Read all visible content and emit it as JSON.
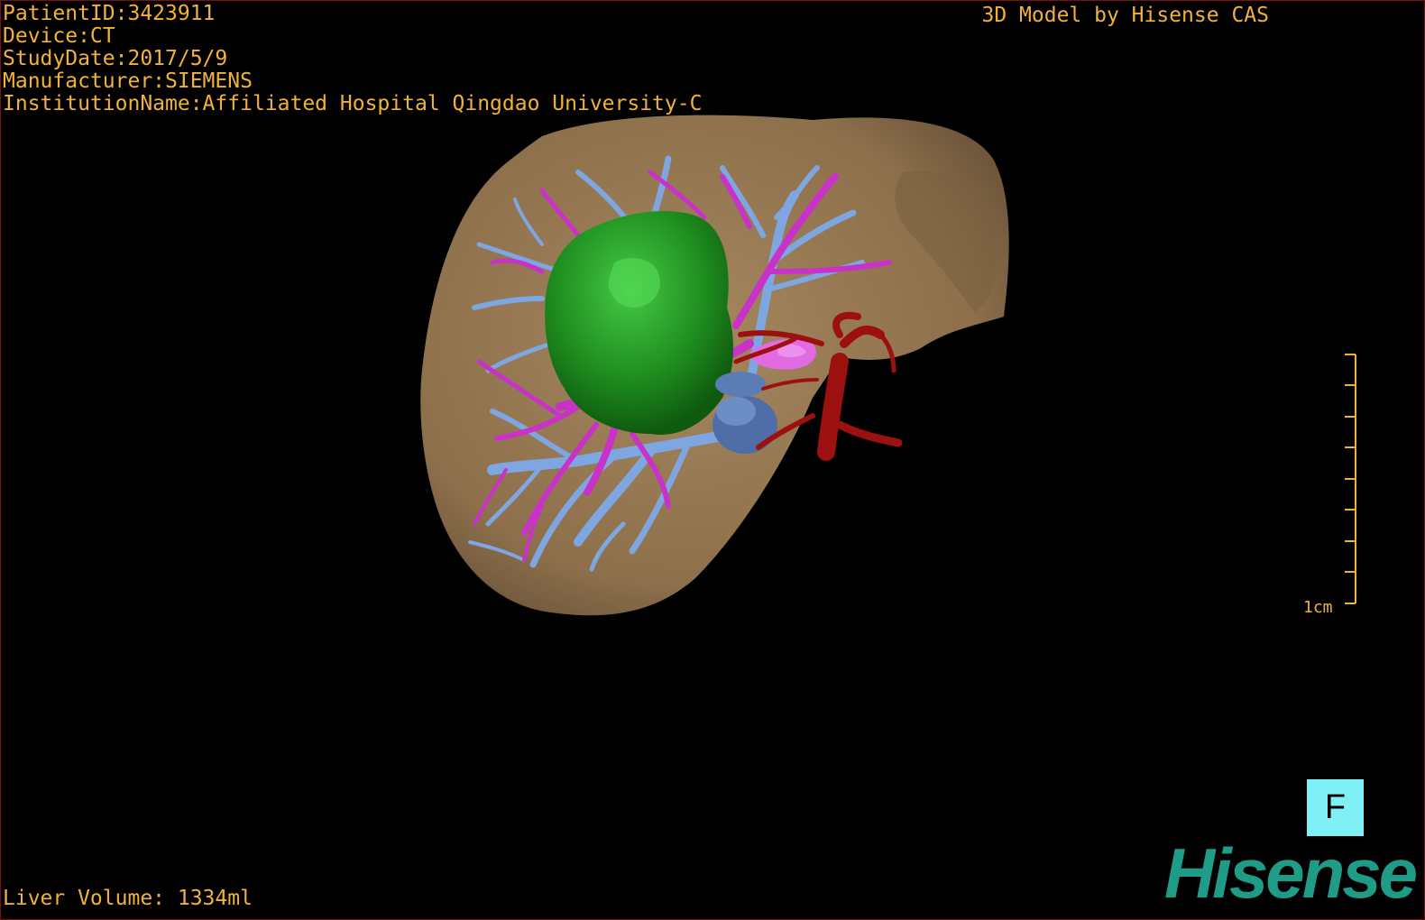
{
  "overlay": {
    "patient_id": "PatientID:3423911",
    "device": "Device:CT",
    "study_date": "StudyDate:2017/5/9",
    "manufacturer": "Manufacturer:SIEMENS",
    "institution": "InstitutionName:Affiliated Hospital Qingdao University-C",
    "brand_text": "3D Model by Hisense CAS",
    "liver_volume": "Liver Volume: 1334ml"
  },
  "scale_bar": {
    "label": "1cm"
  },
  "orientation": {
    "label": "F"
  },
  "logo": {
    "text": "Hisense"
  },
  "colors": {
    "overlay_text": "#f2b23a",
    "liver": "#9a7b55",
    "tumor": "#1f8a1f",
    "portal_vein": "#7ea6e0",
    "hepatic_vein": "#c832c8",
    "artery": "#9c1010",
    "orientation_box": "#7ff0f5",
    "logo": "#1f9c88"
  }
}
